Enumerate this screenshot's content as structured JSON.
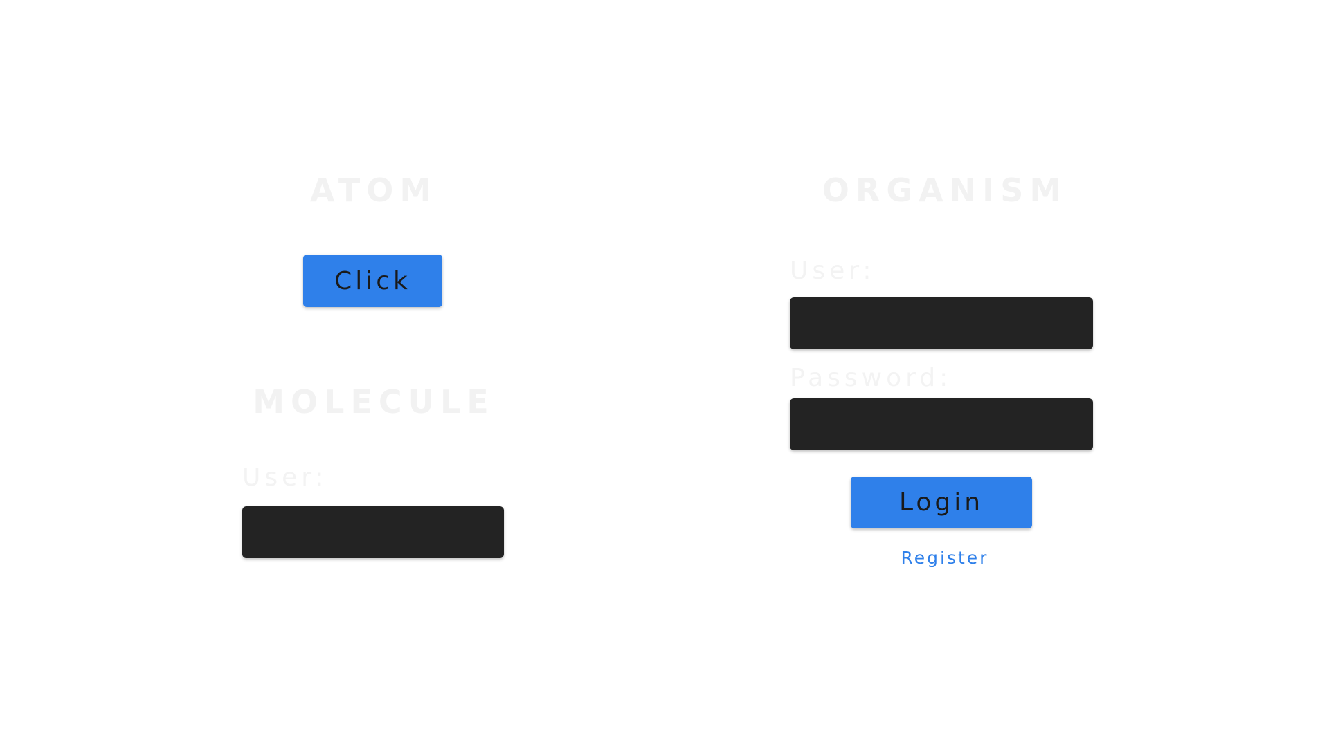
{
  "atom": {
    "title": "ATOM",
    "button_label": "Click"
  },
  "molecule": {
    "title": "MOLECULE",
    "user_label": "User:",
    "user_value": ""
  },
  "organism": {
    "title": "ORGANISM",
    "user_label": "User:",
    "user_value": "",
    "password_label": "Password:",
    "password_value": "",
    "login_label": "Login",
    "register_label": "Register"
  },
  "colors": {
    "button": "#2f80ea",
    "field": "#232323",
    "link": "#2f80ea",
    "heading": "#f2f2f2"
  }
}
